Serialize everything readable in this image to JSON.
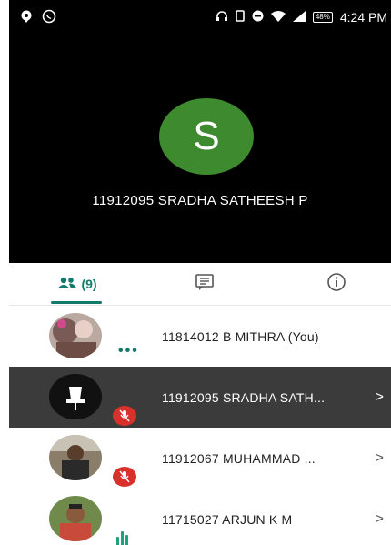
{
  "status_bar": {
    "battery": "48%",
    "time": "4:24 PM"
  },
  "stage": {
    "avatar_initial": "S",
    "avatar_color": "#3e8a2e",
    "speaker_name": "11912095 SRADHA SATHEESH P"
  },
  "tabs": {
    "people_count": "(9)",
    "accent": "#137a6b"
  },
  "participants": [
    {
      "name": "11814012 B MITHRA (You)",
      "status": "speaking-dots",
      "has_chevron": false
    },
    {
      "name": "11912095 SRADHA SATH...",
      "status": "muted",
      "has_chevron": true
    },
    {
      "name": "11912067 MUHAMMAD ...",
      "status": "muted",
      "has_chevron": true
    },
    {
      "name": "11715027 ARJUN K M",
      "status": "audio-active",
      "has_chevron": true
    }
  ]
}
